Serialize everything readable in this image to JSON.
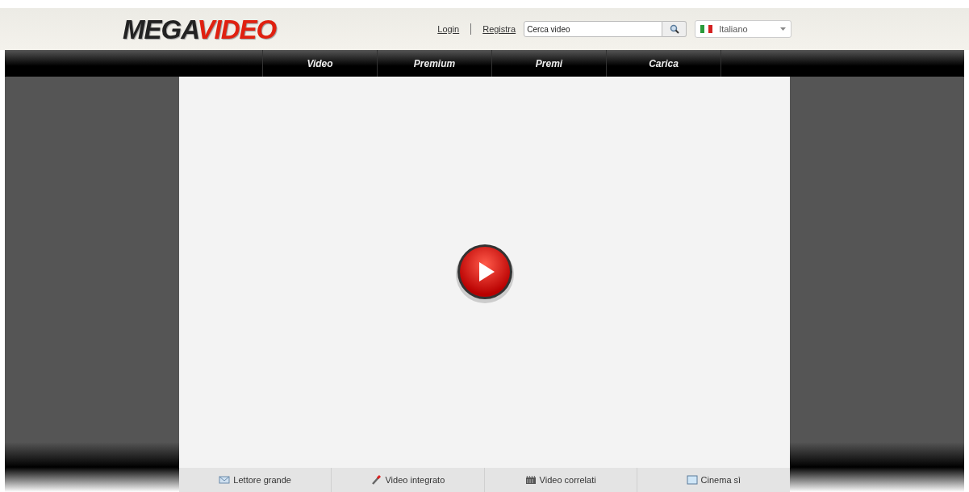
{
  "header": {
    "logo": {
      "dark": "MEGA",
      "red": "VIDEO"
    },
    "links": [
      "Login",
      "Registra"
    ],
    "search": {
      "placeholder": "Cerca video"
    },
    "language": {
      "value": "Italiano"
    }
  },
  "nav": [
    {
      "label": "Video"
    },
    {
      "label": "Premium"
    },
    {
      "label": "Premi"
    },
    {
      "label": "Carica"
    }
  ],
  "player_toolbar": [
    {
      "kind": "mail",
      "label": "Lettore grande"
    },
    {
      "kind": "pen",
      "label": "Video integrato"
    },
    {
      "kind": "film",
      "label": "Video correlati"
    },
    {
      "kind": "screen",
      "label": "Cinema sì"
    }
  ]
}
